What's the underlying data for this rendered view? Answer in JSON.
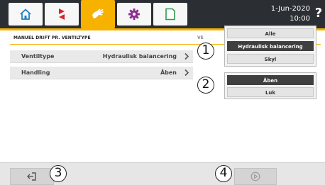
{
  "topbar": {
    "tabs": [
      {
        "name": "home-tab",
        "icon": "home-icon",
        "active": false
      },
      {
        "name": "swap-tab",
        "icon": "swap-arrows-icon",
        "active": false
      },
      {
        "name": "manual-tab",
        "icon": "hand-icon",
        "active": true
      },
      {
        "name": "settings-tab",
        "icon": "gear-icon",
        "active": false
      },
      {
        "name": "document-tab",
        "icon": "document-icon",
        "active": false
      }
    ],
    "date": "1-Jun-2020",
    "time": "10:00",
    "help_label": "?"
  },
  "header": {
    "title": "MANUEL DRIFT PR. VENTILTYPE",
    "fragment": "VE"
  },
  "rows": [
    {
      "label": "Ventiltype",
      "value": "Hydraulisk balancering"
    },
    {
      "label": "Handling",
      "value": "Åben"
    }
  ],
  "dropdown1": {
    "options": [
      "Alle",
      "Hydraulisk balancering",
      "Skyl"
    ],
    "selected": "Hydraulisk balancering"
  },
  "dropdown2": {
    "options": [
      "Åben",
      "Luk"
    ],
    "selected": "Åben"
  },
  "callouts": [
    "1",
    "2",
    "3",
    "4"
  ],
  "bottombar": {
    "back_icon": "exit-icon",
    "play_icon": "play-icon"
  },
  "colors": {
    "topbar": "#2b2f33",
    "accent": "#f7b200",
    "selected_option": "#3f3f3f"
  }
}
